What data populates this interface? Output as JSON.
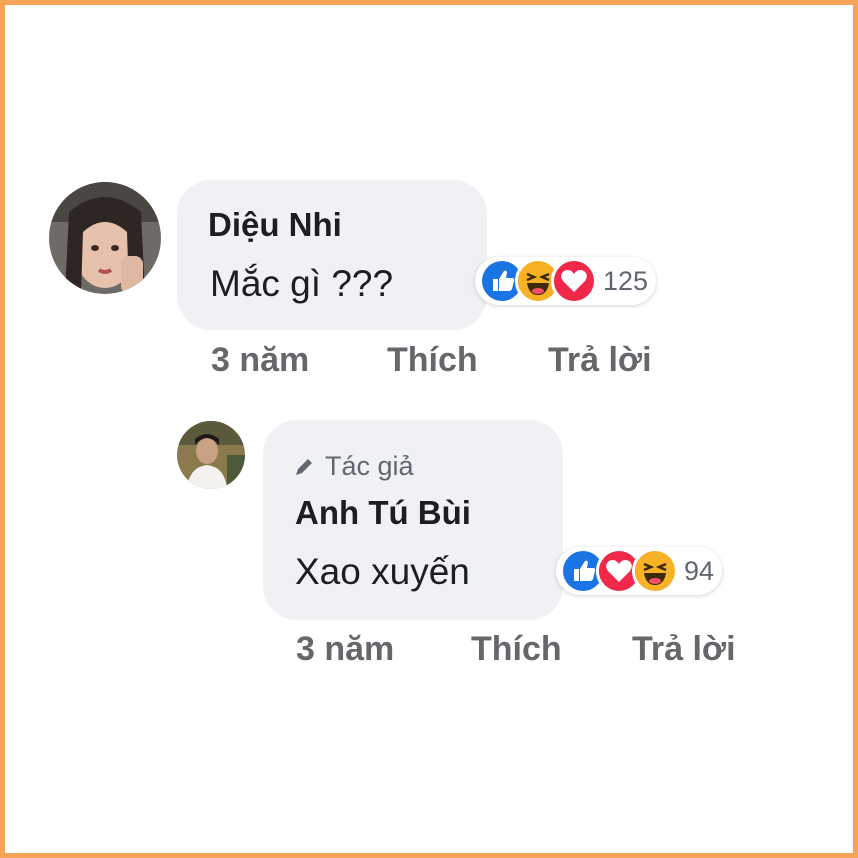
{
  "comment": {
    "author": "Diệu Nhi",
    "text": "Mắc gì ???",
    "reactions": [
      "like-icon",
      "haha-icon",
      "love-icon"
    ],
    "reaction_count": "125",
    "time": "3 năm",
    "like_label": "Thích",
    "reply_label": "Trả lời"
  },
  "reply": {
    "badge": "Tác giả",
    "author": "Anh Tú Bùi",
    "text": "Xao xuyến",
    "reactions": [
      "like-icon",
      "love-icon",
      "haha-icon"
    ],
    "reaction_count": "94",
    "time": "3 năm",
    "like_label": "Thích",
    "reply_label": "Trả lời"
  },
  "colors": {
    "frame": "#f3a456",
    "bubble": "#f0f1f4",
    "like": "#1b74e4",
    "love": "#f0284a",
    "haha": "#f7b125"
  }
}
